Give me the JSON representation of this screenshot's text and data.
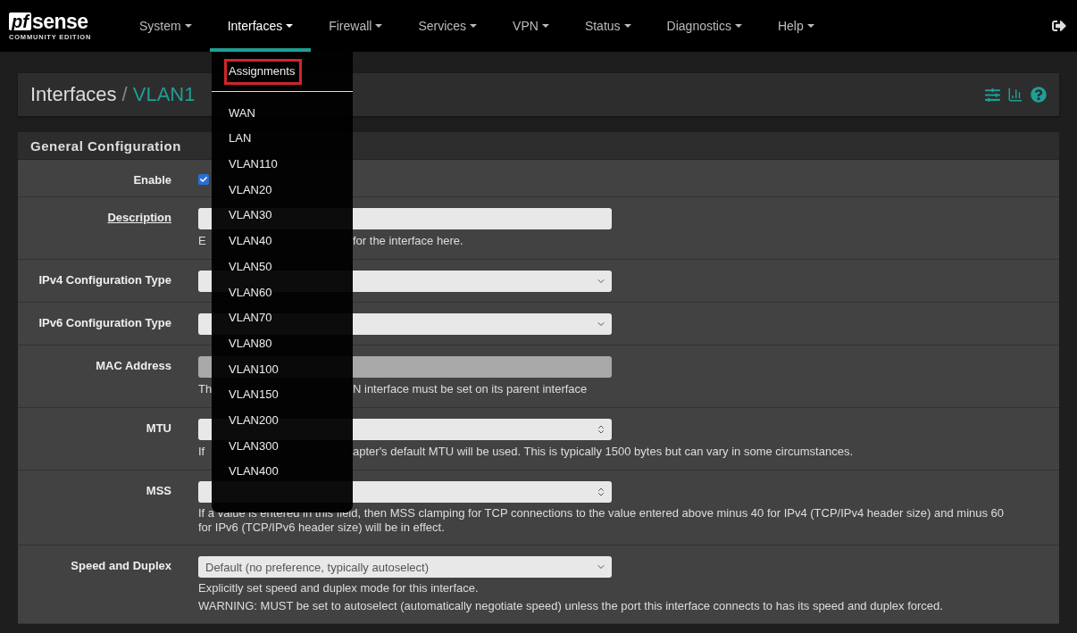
{
  "logo": {
    "prefix": "pf",
    "name": "sense",
    "edition": "COMMUNITY EDITION"
  },
  "nav": [
    {
      "label": "System",
      "selected": false
    },
    {
      "label": "Interfaces",
      "selected": true
    },
    {
      "label": "Firewall",
      "selected": false
    },
    {
      "label": "Services",
      "selected": false
    },
    {
      "label": "VPN",
      "selected": false
    },
    {
      "label": "Status",
      "selected": false
    },
    {
      "label": "Diagnostics",
      "selected": false
    },
    {
      "label": "Help",
      "selected": false
    }
  ],
  "dropdown": {
    "items": [
      {
        "label": "Assignments",
        "marked": true,
        "divider_after": true
      },
      {
        "label": "WAN",
        "marked": false
      },
      {
        "label": "LAN",
        "marked": false
      },
      {
        "label": "VLAN110",
        "marked": false
      },
      {
        "label": "VLAN20",
        "marked": false
      },
      {
        "label": "VLAN30",
        "marked": false
      },
      {
        "label": "VLAN40",
        "marked": false
      },
      {
        "label": "VLAN50",
        "marked": false
      },
      {
        "label": "VLAN60",
        "marked": false
      },
      {
        "label": "VLAN70",
        "marked": false
      },
      {
        "label": "VLAN80",
        "marked": false
      },
      {
        "label": "VLAN100",
        "marked": false
      },
      {
        "label": "VLAN150",
        "marked": false
      },
      {
        "label": "VLAN200",
        "marked": false
      },
      {
        "label": "VLAN300",
        "marked": false
      },
      {
        "label": "VLAN400",
        "marked": false
      }
    ]
  },
  "breadcrumb": {
    "section": "Interfaces",
    "separator": "/",
    "page": "VLAN1"
  },
  "panel": {
    "title": "General Configuration",
    "rows": [
      {
        "kind": "checkbox",
        "label": "Enable",
        "underlined": false,
        "checked": true
      },
      {
        "kind": "text",
        "label": "Description",
        "underlined": true,
        "disabled": false,
        "help": [
          {
            "kind": "covered",
            "start": "E",
            "end": "for the interface here."
          }
        ]
      },
      {
        "kind": "select",
        "label": "IPv4 Configuration Type",
        "underlined": false
      },
      {
        "kind": "select",
        "label": "IPv6 Configuration Type",
        "underlined": false
      },
      {
        "kind": "text",
        "label": "MAC Address",
        "underlined": false,
        "disabled": true,
        "help": [
          {
            "kind": "covered",
            "start": "Th",
            "end": "N interface must be set on its parent interface"
          }
        ]
      },
      {
        "kind": "number",
        "label": "MTU",
        "underlined": false,
        "help": [
          {
            "kind": "covered",
            "start": "If",
            "end": "apter's default MTU will be used. This is typically 1500 bytes but can vary in some circumstances."
          }
        ]
      },
      {
        "kind": "number",
        "label": "MSS",
        "underlined": false,
        "help": [
          {
            "kind": "plain",
            "text": "If a value is entered in this field, then MSS clamping for TCP connections to the value entered above minus 40 for IPv4 (TCP/IPv4 header size) and minus 60 for IPv6 (TCP/IPv6 header size) will be in effect."
          }
        ]
      },
      {
        "kind": "select",
        "label": "Speed and Duplex",
        "underlined": false,
        "value": "Default (no preference, typically autoselect)",
        "help": [
          {
            "kind": "plain",
            "text": "Explicitly set speed and duplex mode for this interface."
          },
          {
            "kind": "plain",
            "text": "WARNING: MUST be set to autoselect (automatically negotiate speed) unless the port this interface connects to has its speed and duplex forced."
          }
        ]
      }
    ]
  }
}
